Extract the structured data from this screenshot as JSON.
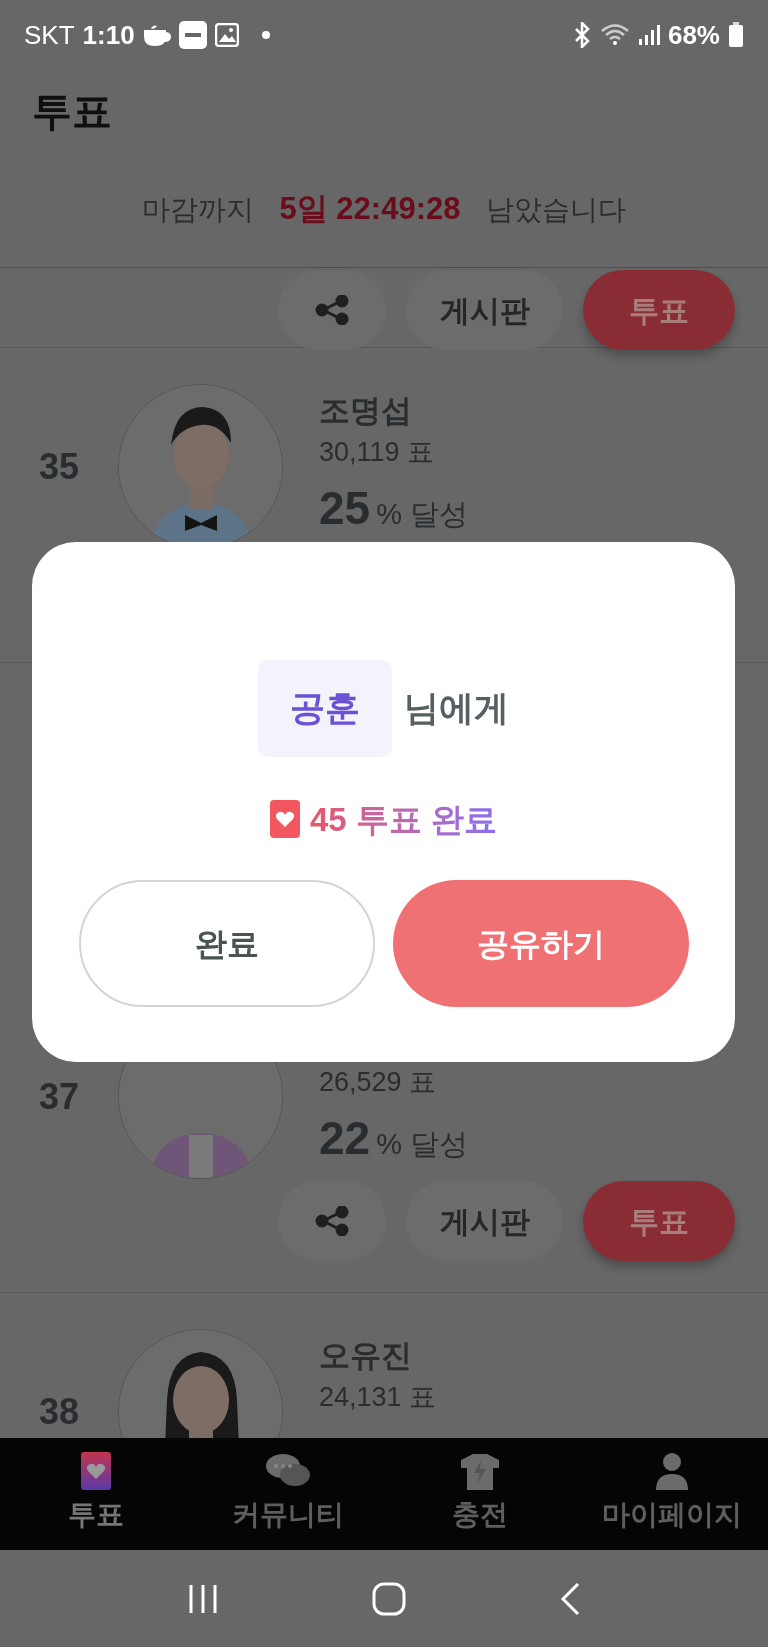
{
  "status_bar": {
    "carrier": "SKT",
    "time": "1:10",
    "battery": "68%"
  },
  "header": {
    "title": "투표"
  },
  "countdown": {
    "prefix": "마감까지",
    "remaining": "5일 22:49:28",
    "suffix": "남았습니다"
  },
  "rows": [
    {
      "kind": "actions",
      "board": "게시판",
      "vote": "투표"
    },
    {
      "kind": "candidate",
      "rank": "35",
      "name": "조명섭",
      "votes": "30,119 표",
      "percent": "25",
      "percent_unit": "% 달성"
    },
    {
      "kind": "candidate",
      "rank": "37",
      "votes": "26,529 표",
      "percent": "22",
      "percent_unit": "% 달성",
      "board": "게시판",
      "vote": "투표"
    },
    {
      "kind": "candidate",
      "rank": "38",
      "name": "오유진",
      "votes": "24,131 표"
    }
  ],
  "dialog": {
    "recipient": "공훈",
    "recipient_suffix": "님에게",
    "result": "45 투표 완료",
    "buttons": [
      {
        "label": "완료",
        "kind": "secondary"
      },
      {
        "label": "공유하기",
        "kind": "primary"
      }
    ]
  },
  "bottom_nav": [
    {
      "kind": "vote",
      "label": "투표",
      "selected": true
    },
    {
      "kind": "community",
      "label": "커뮤니티",
      "selected": false
    },
    {
      "kind": "charge",
      "label": "충전",
      "selected": false
    },
    {
      "kind": "mypage",
      "label": "마이페이지",
      "selected": false
    }
  ]
}
